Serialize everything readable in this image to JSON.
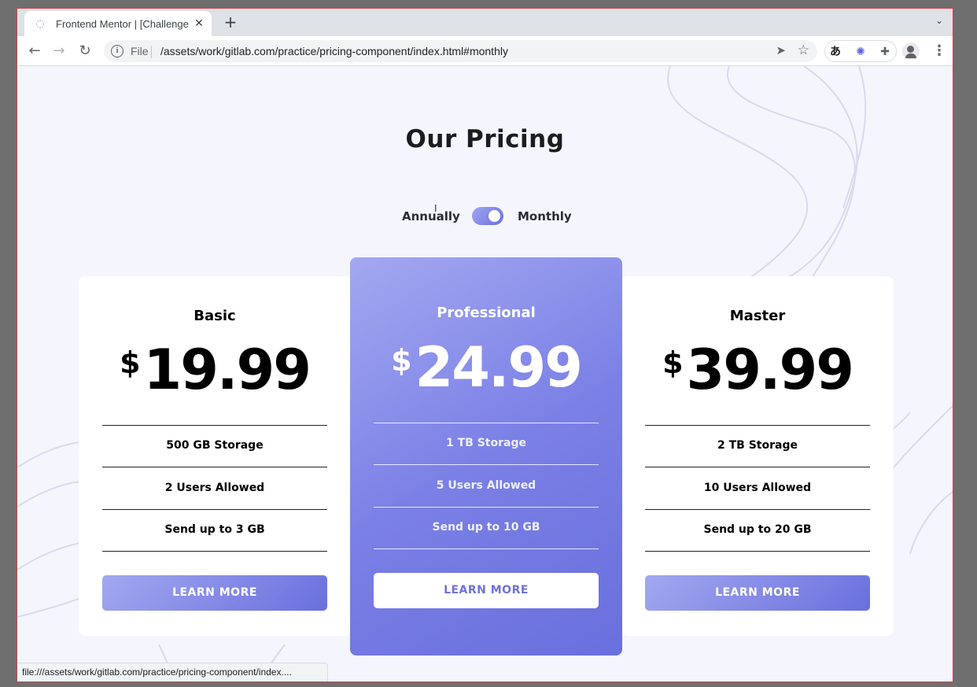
{
  "browser": {
    "tab_title": "Frontend Mentor | [Challenge Name",
    "tab_favicon": "favicon-icon",
    "new_tab_label": "+",
    "scheme_label": "File",
    "url": "/assets/work/gitlab.com/practice/pricing-component/index.html#monthly",
    "status_url": "file:///assets/work/gitlab.com/practice/pricing-component/index...."
  },
  "page": {
    "heading": "Our Pricing",
    "toggle": {
      "left_label": "Annually",
      "right_label": "Monthly",
      "state": "Monthly"
    },
    "currency_symbol": "$",
    "plans": [
      {
        "name": "Basic",
        "price": "19.99",
        "features": [
          "500 GB Storage",
          "2 Users Allowed",
          "Send up to 3 GB"
        ],
        "button": "LEARN MORE"
      },
      {
        "name": "Professional",
        "price": "24.99",
        "features": [
          "1 TB Storage",
          "5 Users Allowed",
          "Send up to 10 GB"
        ],
        "button": "LEARN MORE"
      },
      {
        "name": "Master",
        "price": "39.99",
        "features": [
          "2 TB Storage",
          "10 Users Allowed",
          "Send up to 20 GB"
        ],
        "button": "LEARN MORE"
      }
    ]
  },
  "colors": {
    "accent_start": "#a3a8f0",
    "accent_end": "#696fdd",
    "page_background": "#f5f5fd"
  }
}
